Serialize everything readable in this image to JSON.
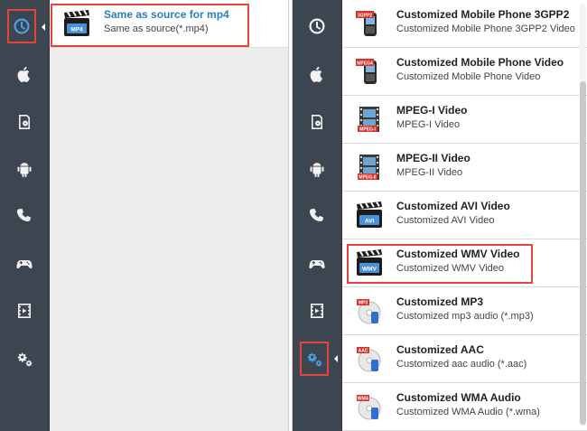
{
  "left_panel": {
    "sidebar": [
      {
        "icon": "clock-icon"
      },
      {
        "icon": "apple-icon"
      },
      {
        "icon": "disc-icon"
      },
      {
        "icon": "android-icon"
      },
      {
        "icon": "phone-icon"
      },
      {
        "icon": "gamepad-icon"
      },
      {
        "icon": "film-icon"
      },
      {
        "icon": "gears-icon"
      }
    ],
    "formats": [
      {
        "title": "Same as source for mp4",
        "subtitle": "Same as source(*.mp4)",
        "badge": "MP4"
      }
    ]
  },
  "right_panel": {
    "sidebar": [
      {
        "icon": "clock-icon"
      },
      {
        "icon": "apple-icon"
      },
      {
        "icon": "disc-icon"
      },
      {
        "icon": "android-icon"
      },
      {
        "icon": "phone-icon"
      },
      {
        "icon": "gamepad-icon"
      },
      {
        "icon": "film-icon"
      },
      {
        "icon": "gears-icon"
      }
    ],
    "formats": [
      {
        "title": "Customized Mobile Phone 3GPP2",
        "subtitle": "Customized Mobile Phone 3GPP2 Video",
        "badge": "3GPP2"
      },
      {
        "title": "Customized Mobile Phone Video",
        "subtitle": "Customized Mobile Phone Video",
        "badge": "MPEG4"
      },
      {
        "title": "MPEG-I Video",
        "subtitle": "MPEG-I Video",
        "badge": "MPEG-I"
      },
      {
        "title": "MPEG-II Video",
        "subtitle": "MPEG-II Video",
        "badge": "MPEG-II"
      },
      {
        "title": "Customized AVI Video",
        "subtitle": "Customized AVI Video",
        "badge": "AVI"
      },
      {
        "title": "Customized WMV Video",
        "subtitle": "Customized WMV Video",
        "badge": "WMV"
      },
      {
        "title": "Customized MP3",
        "subtitle": "Customized mp3 audio (*.mp3)",
        "badge": "MP3"
      },
      {
        "title": "Customized AAC",
        "subtitle": "Customized aac audio (*.aac)",
        "badge": "AAC"
      },
      {
        "title": "Customized WMA Audio",
        "subtitle": "Customized WMA Audio (*.wma)",
        "badge": "WMA"
      }
    ]
  },
  "colors": {
    "sidebar_bg": "#3d4551",
    "highlight": "#e0463a",
    "selected_text": "#2a7fc2",
    "active_icon": "#4aa3df"
  }
}
